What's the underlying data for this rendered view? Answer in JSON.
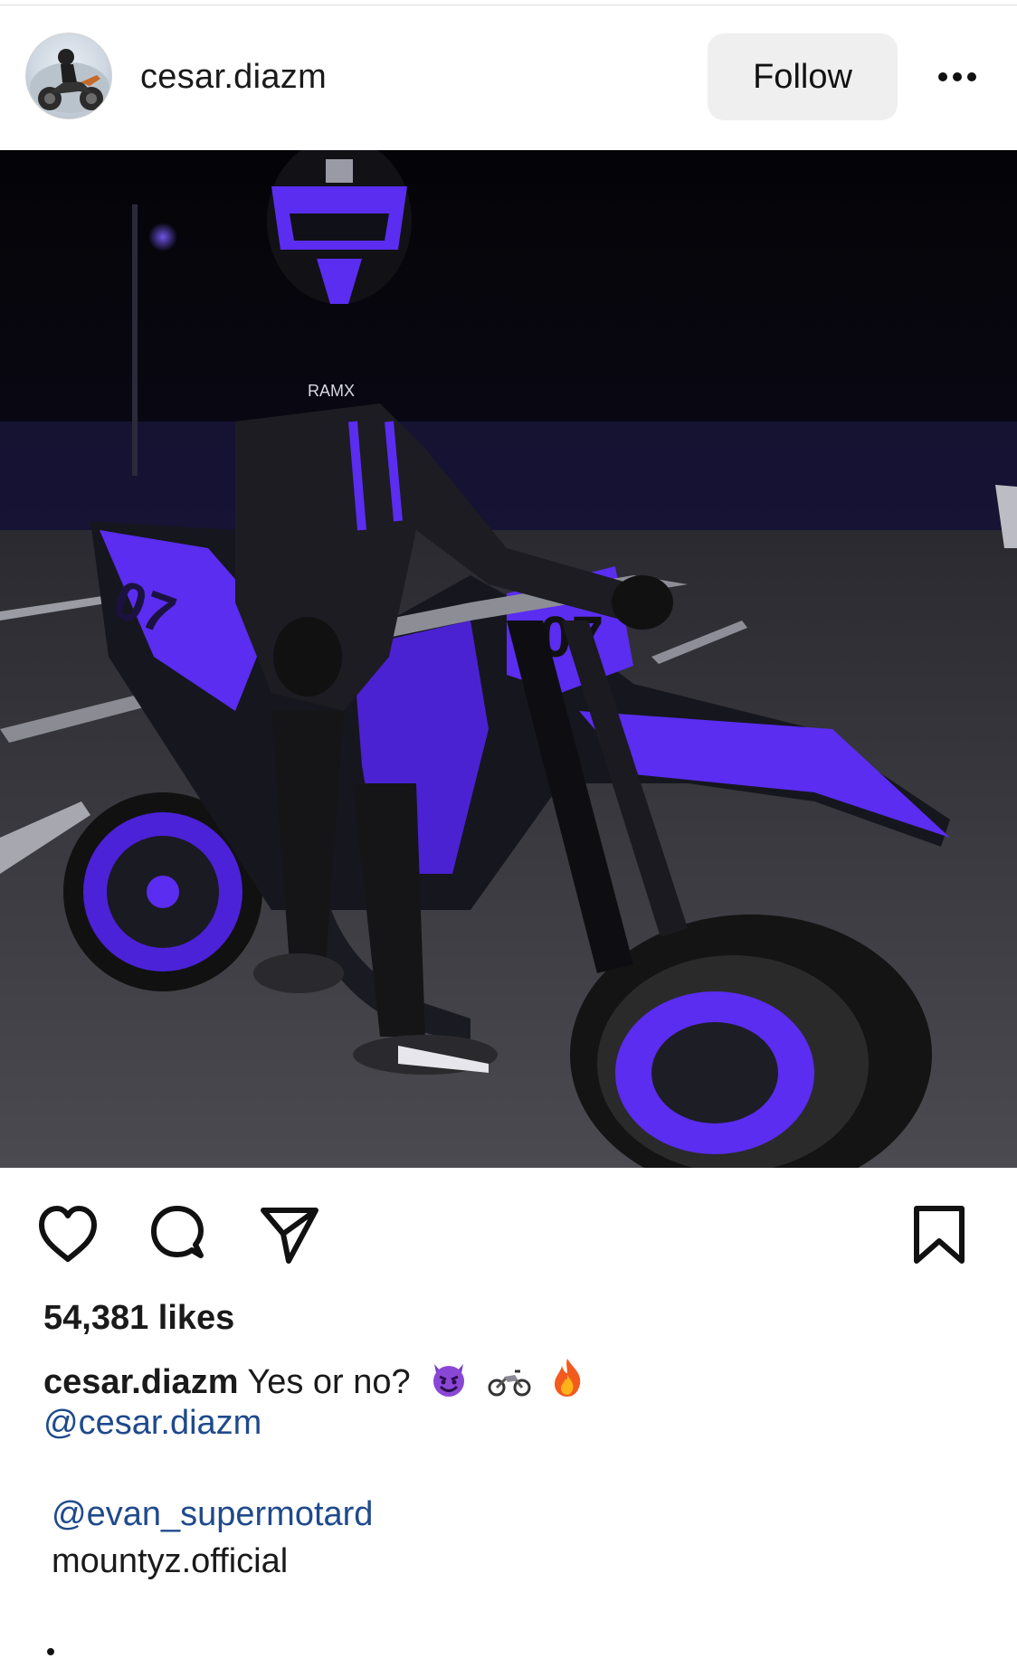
{
  "post": {
    "username": "cesar.diazm",
    "follow_label": "Follow",
    "likes_text": "54,381 likes",
    "caption_user": "cesar.diazm",
    "caption_text": "Yes or no?",
    "caption_emojis": [
      "smiling-devil",
      "motorcycle",
      "fire"
    ],
    "mention_1": "@cesar.diazm",
    "mention_2": "@evan_supermotard",
    "plain_line": "mountyz.official",
    "trailing": "."
  },
  "photo": {
    "subject": "rider-on-purple-supermoto",
    "number_plate": "07",
    "hoodie_text": "RAMX"
  },
  "colors": {
    "accent_purple": "#5a2df0",
    "mention_blue": "#1f4a8c",
    "follow_bg": "#efefef"
  }
}
